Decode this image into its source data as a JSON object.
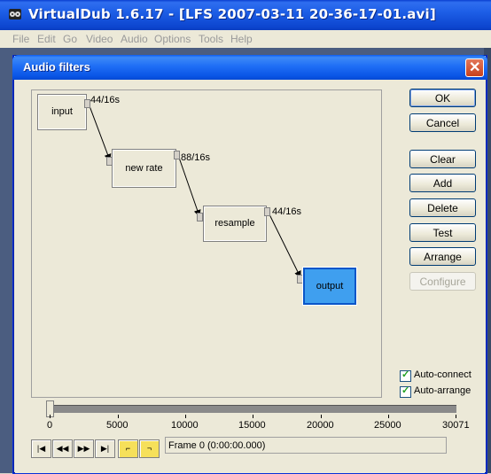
{
  "app": {
    "title": "VirtualDub 1.6.17 - [LFS 2007-03-11 20-36-17-01.avi]",
    "menu": [
      "File",
      "Edit",
      "Go",
      "Video",
      "Audio",
      "Options",
      "Tools",
      "Help"
    ]
  },
  "dialog": {
    "title": "Audio filters",
    "close_label": "✕",
    "graph": {
      "nodes": [
        {
          "label": "input",
          "out_format": "44/16s"
        },
        {
          "label": "new rate",
          "out_format": "88/16s"
        },
        {
          "label": "resample",
          "out_format": "44/16s"
        },
        {
          "label": "output",
          "selected": true
        }
      ]
    },
    "buttons": {
      "ok": "OK",
      "cancel": "Cancel",
      "clear": "Clear",
      "add": "Add",
      "delete": "Delete",
      "test": "Test",
      "arrange": "Arrange",
      "configure": "Configure"
    },
    "options": {
      "auto_connect": {
        "label": "Auto-connect",
        "checked": true
      },
      "auto_arrange": {
        "label": "Auto-arrange",
        "checked": true
      }
    }
  },
  "timeline": {
    "ticks": [
      "0",
      "5000",
      "10000",
      "15000",
      "20000",
      "25000",
      "30071"
    ],
    "max_frame": 30071,
    "position": 0,
    "frame_text": "Frame 0 (0:00:00.000)",
    "buttons": [
      "stop-icon",
      "rewind-icon",
      "fast-forward-icon",
      "end-icon",
      "mark-in-icon",
      "mark-out-icon"
    ]
  },
  "colors": {
    "selected_node": "#3f9fef",
    "titlebar": "#0a55e6",
    "face": "#ece9d8"
  }
}
